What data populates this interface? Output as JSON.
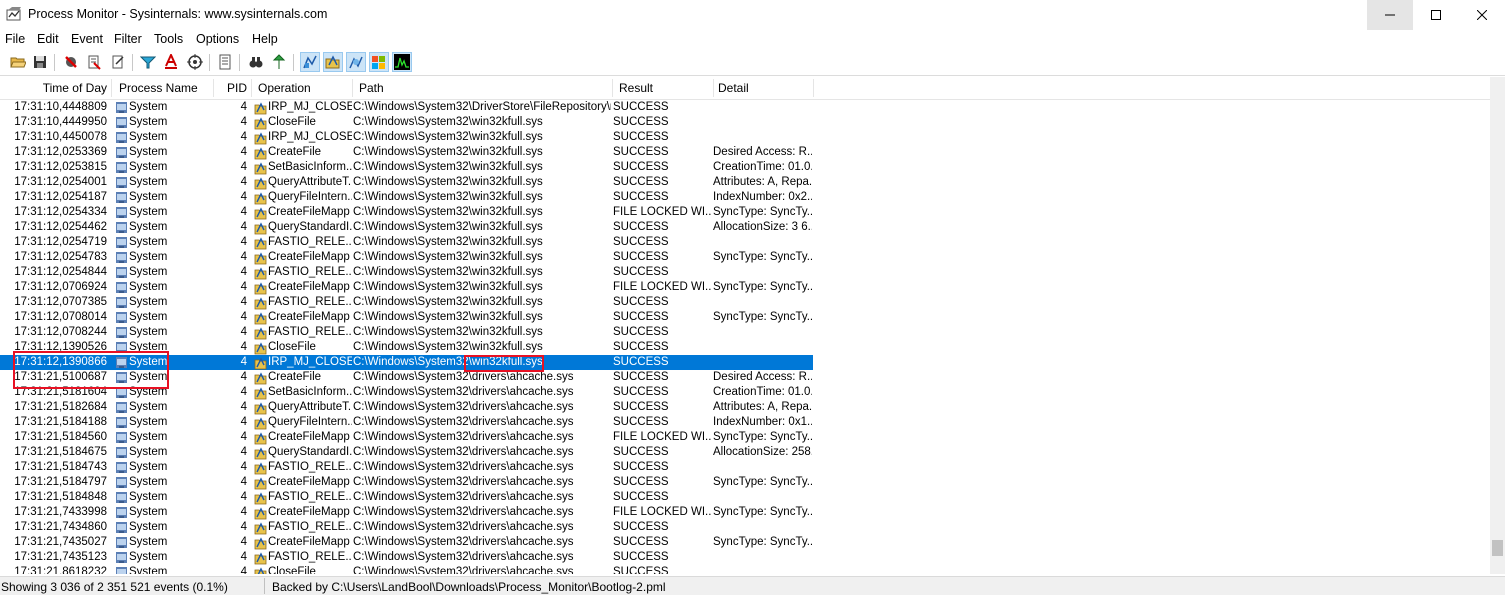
{
  "window": {
    "title": "Process Monitor - Sysinternals: www.sysinternals.com"
  },
  "menu": [
    "File",
    "Edit",
    "Event",
    "Filter",
    "Tools",
    "Options",
    "Help"
  ],
  "toolbar": {
    "icons": [
      "open-icon",
      "save-icon",
      "capture-icon",
      "autoscroll-icon",
      "clear-icon",
      "filter-icon",
      "highlight-icon",
      "target-icon",
      "process-tree-icon",
      "find-icon",
      "jump-icon",
      "registry-activity-icon",
      "file-activity-icon",
      "network-activity-icon",
      "process-activity-icon",
      "profiling-icon"
    ]
  },
  "columns": [
    "Time of Day",
    "Process Name",
    "PID",
    "Operation",
    "Path",
    "Result",
    "Detail"
  ],
  "rows": [
    {
      "time": "17:31:10,4448809",
      "proc": "System",
      "pid": "4",
      "op": "IRP_MJ_CLOSE",
      "path": "C:\\Windows\\System32\\DriverStore\\FileRepository\\n...",
      "result": "SUCCESS",
      "detail": ""
    },
    {
      "time": "17:31:10,4449950",
      "proc": "System",
      "pid": "4",
      "op": "CloseFile",
      "path": "C:\\Windows\\System32\\win32kfull.sys",
      "result": "SUCCESS",
      "detail": ""
    },
    {
      "time": "17:31:10,4450078",
      "proc": "System",
      "pid": "4",
      "op": "IRP_MJ_CLOSE",
      "path": "C:\\Windows\\System32\\win32kfull.sys",
      "result": "SUCCESS",
      "detail": ""
    },
    {
      "time": "17:31:12,0253369",
      "proc": "System",
      "pid": "4",
      "op": "CreateFile",
      "path": "C:\\Windows\\System32\\win32kfull.sys",
      "result": "SUCCESS",
      "detail": "Desired Access: R..."
    },
    {
      "time": "17:31:12,0253815",
      "proc": "System",
      "pid": "4",
      "op": "SetBasicInform...",
      "path": "C:\\Windows\\System32\\win32kfull.sys",
      "result": "SUCCESS",
      "detail": "CreationTime: 01.0..."
    },
    {
      "time": "17:31:12,0254001",
      "proc": "System",
      "pid": "4",
      "op": "QueryAttributeT...",
      "path": "C:\\Windows\\System32\\win32kfull.sys",
      "result": "SUCCESS",
      "detail": "Attributes: A, Repa..."
    },
    {
      "time": "17:31:12,0254187",
      "proc": "System",
      "pid": "4",
      "op": "QueryFileIntern...",
      "path": "C:\\Windows\\System32\\win32kfull.sys",
      "result": "SUCCESS",
      "detail": "IndexNumber: 0x2..."
    },
    {
      "time": "17:31:12,0254334",
      "proc": "System",
      "pid": "4",
      "op": "CreateFileMapp",
      "path": "C:\\Windows\\System32\\win32kfull.sys",
      "result": "FILE LOCKED WI...",
      "detail": "SyncType: SyncTy..."
    },
    {
      "time": "17:31:12,0254462",
      "proc": "System",
      "pid": "4",
      "op": "QueryStandardI...",
      "path": "C:\\Windows\\System32\\win32kfull.sys",
      "result": "SUCCESS",
      "detail": "AllocationSize: 3 6..."
    },
    {
      "time": "17:31:12,0254719",
      "proc": "System",
      "pid": "4",
      "op": "FASTIO_RELE...",
      "path": "C:\\Windows\\System32\\win32kfull.sys",
      "result": "SUCCESS",
      "detail": ""
    },
    {
      "time": "17:31:12,0254783",
      "proc": "System",
      "pid": "4",
      "op": "CreateFileMapp",
      "path": "C:\\Windows\\System32\\win32kfull.sys",
      "result": "SUCCESS",
      "detail": "SyncType: SyncTy..."
    },
    {
      "time": "17:31:12,0254844",
      "proc": "System",
      "pid": "4",
      "op": "FASTIO_RELE...",
      "path": "C:\\Windows\\System32\\win32kfull.sys",
      "result": "SUCCESS",
      "detail": ""
    },
    {
      "time": "17:31:12,0706924",
      "proc": "System",
      "pid": "4",
      "op": "CreateFileMapp",
      "path": "C:\\Windows\\System32\\win32kfull.sys",
      "result": "FILE LOCKED WI...",
      "detail": "SyncType: SyncTy..."
    },
    {
      "time": "17:31:12,0707385",
      "proc": "System",
      "pid": "4",
      "op": "FASTIO_RELE...",
      "path": "C:\\Windows\\System32\\win32kfull.sys",
      "result": "SUCCESS",
      "detail": ""
    },
    {
      "time": "17:31:12,0708014",
      "proc": "System",
      "pid": "4",
      "op": "CreateFileMapp",
      "path": "C:\\Windows\\System32\\win32kfull.sys",
      "result": "SUCCESS",
      "detail": "SyncType: SyncTy..."
    },
    {
      "time": "17:31:12,0708244",
      "proc": "System",
      "pid": "4",
      "op": "FASTIO_RELE...",
      "path": "C:\\Windows\\System32\\win32kfull.sys",
      "result": "SUCCESS",
      "detail": ""
    },
    {
      "time": "17:31:12,1390526",
      "proc": "System",
      "pid": "4",
      "op": "CloseFile",
      "path": "C:\\Windows\\System32\\win32kfull.sys",
      "result": "SUCCESS",
      "detail": ""
    },
    {
      "time": "17:31:12,1390866",
      "proc": "System",
      "pid": "4",
      "op": "IRP_MJ_CLOSE",
      "path": "C:\\Windows\\System32\\win32kfull.sys",
      "result": "SUCCESS",
      "detail": "",
      "selected": true
    },
    {
      "time": "17:31:21,5100687",
      "proc": "System",
      "pid": "4",
      "op": "CreateFile",
      "path": "C:\\Windows\\System32\\drivers\\ahcache.sys",
      "result": "SUCCESS",
      "detail": "Desired Access: R..."
    },
    {
      "time": "17:31:21,5181604",
      "proc": "System",
      "pid": "4",
      "op": "SetBasicInform...",
      "path": "C:\\Windows\\System32\\drivers\\ahcache.sys",
      "result": "SUCCESS",
      "detail": "CreationTime: 01.0..."
    },
    {
      "time": "17:31:21,5182684",
      "proc": "System",
      "pid": "4",
      "op": "QueryAttributeT...",
      "path": "C:\\Windows\\System32\\drivers\\ahcache.sys",
      "result": "SUCCESS",
      "detail": "Attributes: A, Repa..."
    },
    {
      "time": "17:31:21,5184188",
      "proc": "System",
      "pid": "4",
      "op": "QueryFileIntern...",
      "path": "C:\\Windows\\System32\\drivers\\ahcache.sys",
      "result": "SUCCESS",
      "detail": "IndexNumber: 0x1..."
    },
    {
      "time": "17:31:21,5184560",
      "proc": "System",
      "pid": "4",
      "op": "CreateFileMapp",
      "path": "C:\\Windows\\System32\\drivers\\ahcache.sys",
      "result": "FILE LOCKED WI...",
      "detail": "SyncType: SyncTy..."
    },
    {
      "time": "17:31:21,5184675",
      "proc": "System",
      "pid": "4",
      "op": "QueryStandardI...",
      "path": "C:\\Windows\\System32\\drivers\\ahcache.sys",
      "result": "SUCCESS",
      "detail": "AllocationSize: 258..."
    },
    {
      "time": "17:31:21,5184743",
      "proc": "System",
      "pid": "4",
      "op": "FASTIO_RELE...",
      "path": "C:\\Windows\\System32\\drivers\\ahcache.sys",
      "result": "SUCCESS",
      "detail": ""
    },
    {
      "time": "17:31:21,5184797",
      "proc": "System",
      "pid": "4",
      "op": "CreateFileMapp",
      "path": "C:\\Windows\\System32\\drivers\\ahcache.sys",
      "result": "SUCCESS",
      "detail": "SyncType: SyncTy..."
    },
    {
      "time": "17:31:21,5184848",
      "proc": "System",
      "pid": "4",
      "op": "FASTIO_RELE...",
      "path": "C:\\Windows\\System32\\drivers\\ahcache.sys",
      "result": "SUCCESS",
      "detail": ""
    },
    {
      "time": "17:31:21,7433998",
      "proc": "System",
      "pid": "4",
      "op": "CreateFileMapp",
      "path": "C:\\Windows\\System32\\drivers\\ahcache.sys",
      "result": "FILE LOCKED WI...",
      "detail": "SyncType: SyncTy..."
    },
    {
      "time": "17:31:21,7434860",
      "proc": "System",
      "pid": "4",
      "op": "FASTIO_RELE...",
      "path": "C:\\Windows\\System32\\drivers\\ahcache.sys",
      "result": "SUCCESS",
      "detail": ""
    },
    {
      "time": "17:31:21,7435027",
      "proc": "System",
      "pid": "4",
      "op": "CreateFileMapp",
      "path": "C:\\Windows\\System32\\drivers\\ahcache.sys",
      "result": "SUCCESS",
      "detail": "SyncType: SyncTy..."
    },
    {
      "time": "17:31:21,7435123",
      "proc": "System",
      "pid": "4",
      "op": "FASTIO_RELE...",
      "path": "C:\\Windows\\System32\\drivers\\ahcache.sys",
      "result": "SUCCESS",
      "detail": ""
    },
    {
      "time": "17:31:21,8618232",
      "proc": "System",
      "pid": "4",
      "op": "CloseFile",
      "path": "C:\\Windows\\System32\\drivers\\ahcache.sys",
      "result": "SUCCESS",
      "detail": ""
    }
  ],
  "status": {
    "events": "Showing 3 036 of 2 351 521 events (0.1%)",
    "backing": "Backed by C:\\Users\\LandBool\\Downloads\\Process_Monitor\\Bootlog-2.pml"
  },
  "colors": {
    "selection": "#0078d7",
    "annotation": "#e81123"
  }
}
